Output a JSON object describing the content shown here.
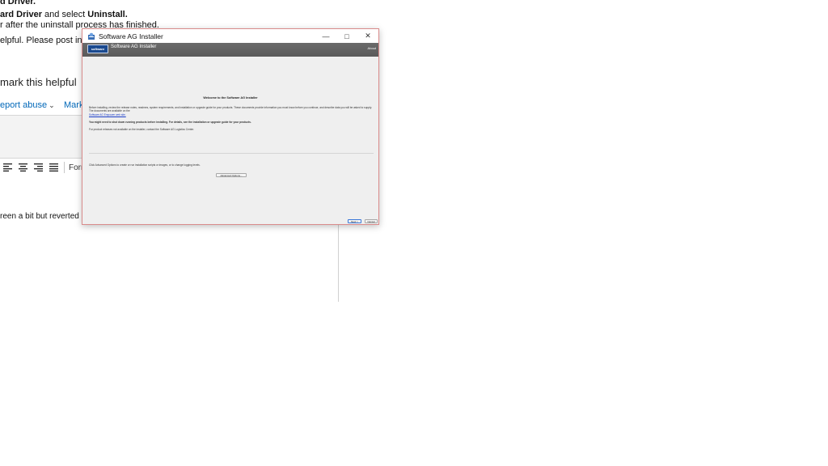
{
  "background": {
    "line1_bold": "d Driver.",
    "line2_bold_a": "ard Driver",
    "line2_mid": " and select ",
    "line2_bold_b": "Uninstall.",
    "line3": "r after the uninstall process has finished.",
    "line4": "elpful. Please post in ca",
    "helpful": "mark this helpful",
    "report_abuse": "eport abuse",
    "mark_link": "Mark",
    "toolbar_format": "Form",
    "reply_text": "reen a bit but reverted i"
  },
  "installer": {
    "window_title": "Software AG Installer",
    "brand_title": "Software AG Installer",
    "logo_text": "software",
    "about": "About",
    "welcome": "Welcome to the Software AG Installer",
    "para1": "Before installing, review the release notes, readmes, system requirements, and installation or upgrade guide for your products. These documents provide information you must know before you continue, and describe data you will be asked to supply. The documents are available on the",
    "link": "Software AG Empower web site.",
    "para2": "You might need to shut down running products before installing. For details, see the installation or upgrade guide for your products.",
    "para3": "For product releases not available on the installer, contact the Software AG Logistics Center.",
    "advanced_text": "Click Advanced Options to create or run installation scripts or images, or to change logging levels.",
    "advanced_button": "Advanced Options...",
    "next_button": "Next >",
    "cancel_button": "Cancel"
  },
  "colors": {
    "link": "#0067b8",
    "brandbar": "#5f5f5f",
    "window_border": "#d98b8b"
  }
}
